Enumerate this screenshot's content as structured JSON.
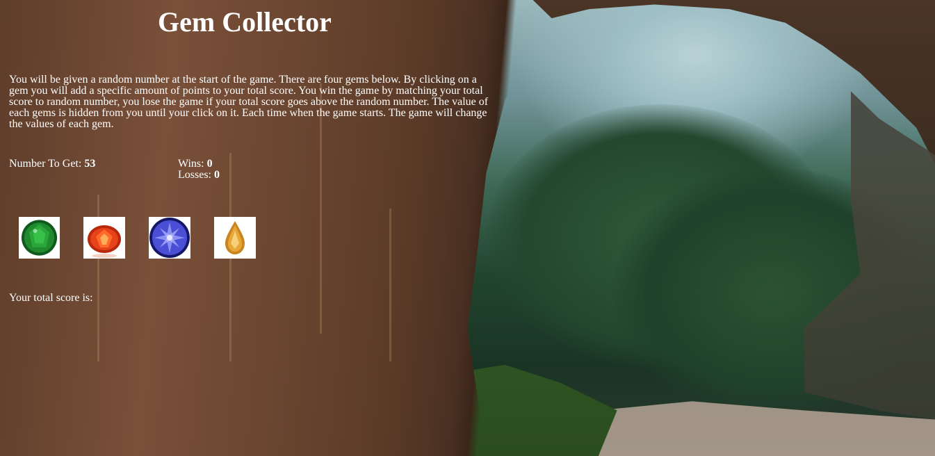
{
  "page": {
    "title": "Gem Collector",
    "background": "cave-jungle-photo"
  },
  "instructions": "You will be given a random number at the start of the game. There are four gems below. By clicking on a gem you will add a specific amount of points to your total score. You win the game by matching your total score to random number, you lose the game if your total score goes above the random number. The value of each gems is hidden from you until your click on it. Each time when the game starts. The game will change the values of each gem.",
  "stats": {
    "target_label": "Number To Get:",
    "target_value": "53",
    "wins_label": "Wins:",
    "wins_value": "0",
    "losses_label": "Losses:",
    "losses_value": "0"
  },
  "gems": [
    {
      "name": "green-emerald",
      "color": "#1f8a2e",
      "icon": "green-gem-icon"
    },
    {
      "name": "red-garnet",
      "color": "#e8421a",
      "icon": "red-gem-icon"
    },
    {
      "name": "blue-sapphire",
      "color": "#4a4fd6",
      "icon": "blue-gem-icon"
    },
    {
      "name": "yellow-citrine",
      "color": "#e0a030",
      "icon": "yellow-gem-icon"
    }
  ],
  "score": {
    "label": "Your total score is:",
    "value": ""
  }
}
